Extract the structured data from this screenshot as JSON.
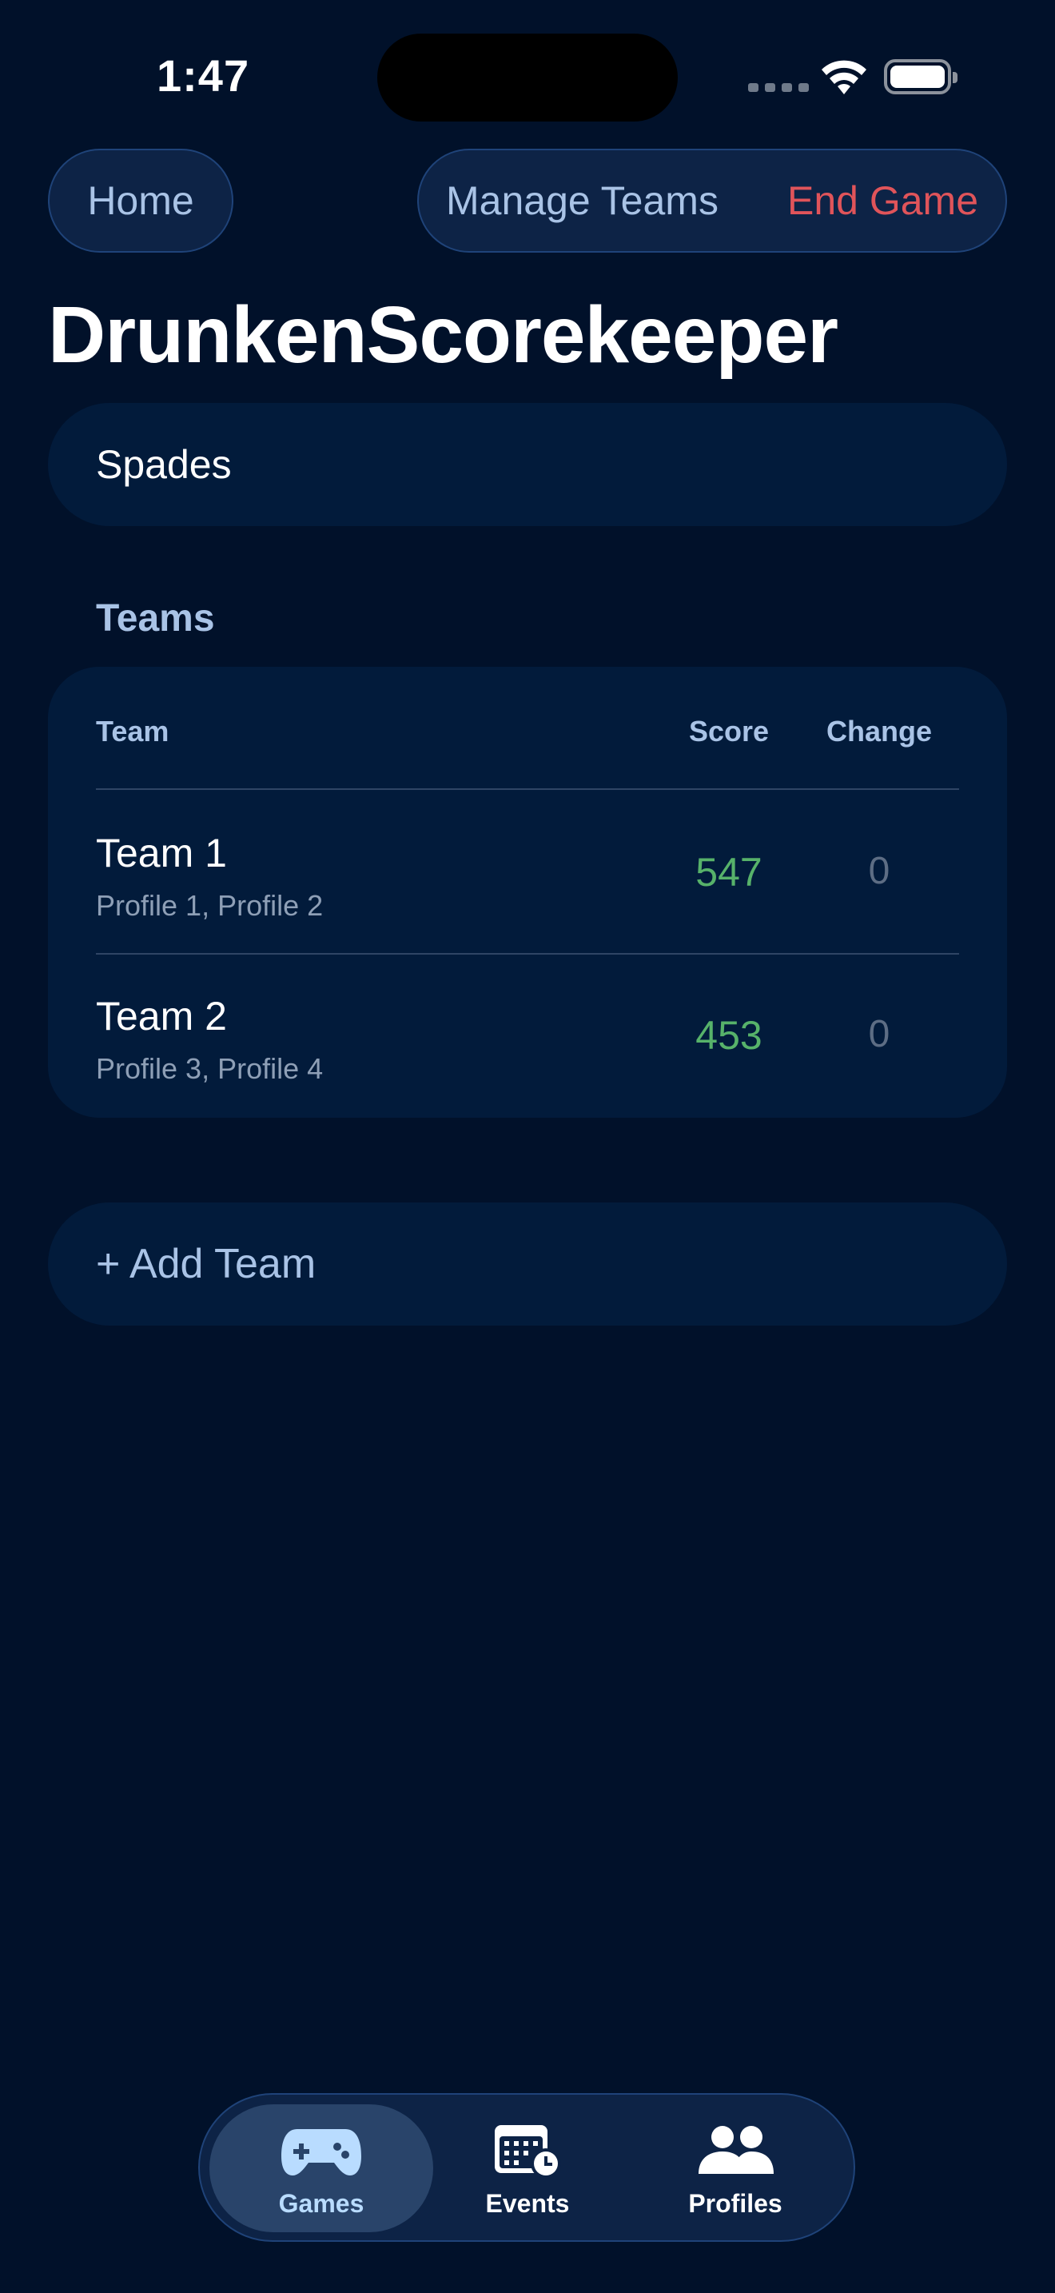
{
  "status_bar": {
    "time": "1:47"
  },
  "nav": {
    "home_label": "Home",
    "manage_teams_label": "Manage Teams",
    "end_game_label": "End Game"
  },
  "page_title": "DrunkenScorekeeper",
  "game_type": "Spades",
  "teams_section": {
    "label": "Teams",
    "columns": {
      "team": "Team",
      "score": "Score",
      "change": "Change"
    },
    "rows": [
      {
        "name": "Team 1",
        "members": "Profile 1, Profile 2",
        "score": "547",
        "change": "0"
      },
      {
        "name": "Team 2",
        "members": "Profile 3, Profile 4",
        "score": "453",
        "change": "0"
      }
    ]
  },
  "add_team_label": "+ Add Team",
  "tabbar": {
    "items": [
      {
        "label": "Games",
        "icon": "gamepad-icon",
        "active": true
      },
      {
        "label": "Events",
        "icon": "calendar-clock-icon",
        "active": false
      },
      {
        "label": "Profiles",
        "icon": "people-icon",
        "active": false
      }
    ]
  },
  "colors": {
    "background": "#01112a",
    "card": "#021b3b",
    "accent": "#a9c3e6",
    "danger": "#e0545a",
    "score": "#57b26a"
  }
}
